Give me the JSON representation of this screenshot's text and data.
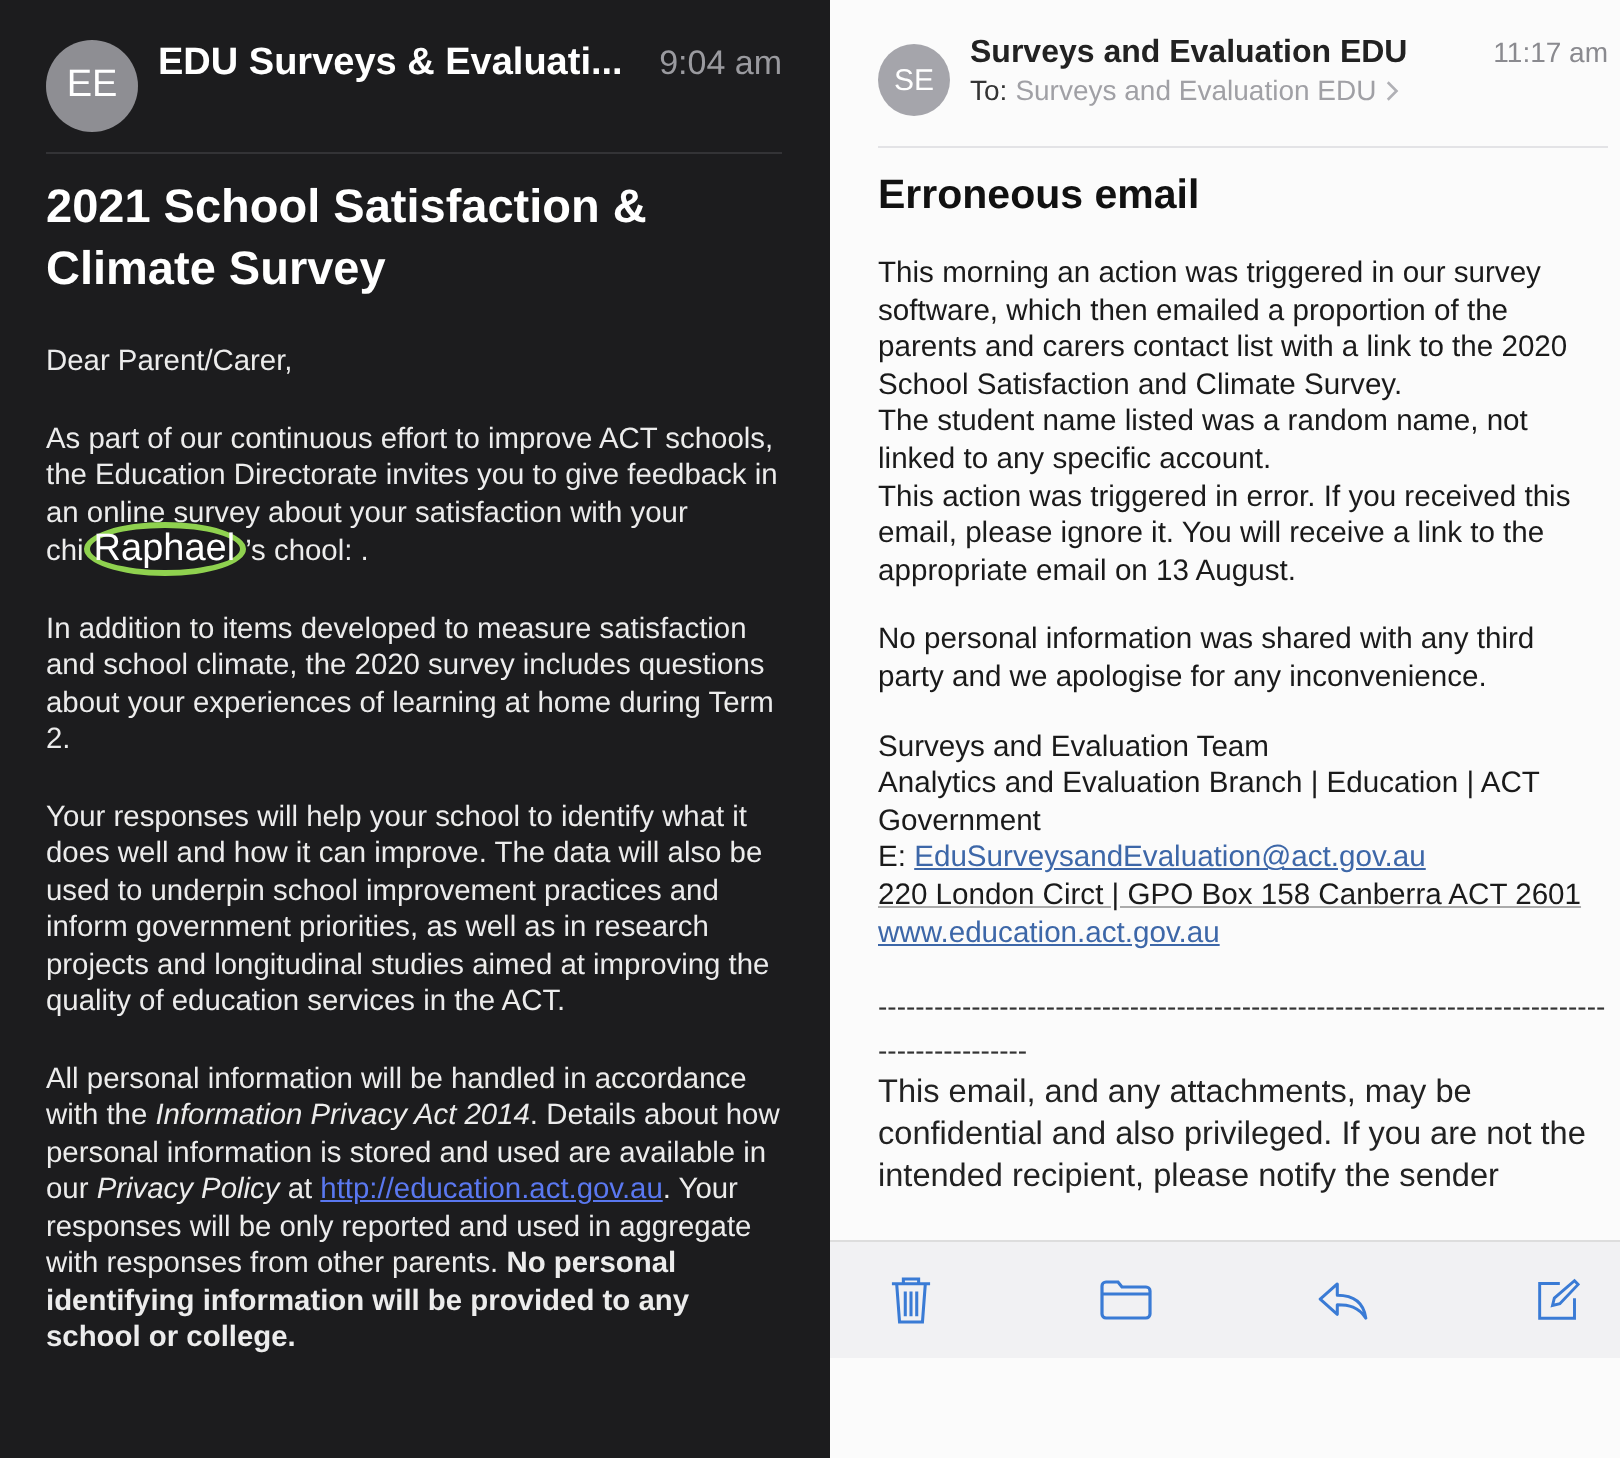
{
  "left_email": {
    "avatar": "EE",
    "sender": "EDU Surveys & Evaluati...",
    "time": "9:04 am",
    "subject": "2021 School Satisfaction & Climate Survey",
    "greeting": "Dear Parent/Carer,",
    "paragraphs": [
      {
        "segments": [
          {
            "kind": "text",
            "text": "As part of our continuous effort to improve ACT schools, the Education Directorate invites you to give feedback in an online survey about your satisfaction with your chi"
          },
          {
            "kind": "annotation",
            "text": "Raphael"
          },
          {
            "kind": "text",
            "text": "’s chool: ."
          }
        ]
      },
      {
        "segments": [
          {
            "kind": "text",
            "text": "In addition to items developed to measure satisfaction and school climate, the 2020 survey includes questions about your experiences of learning at home during Term 2."
          }
        ]
      },
      {
        "segments": [
          {
            "kind": "text",
            "text": "Your responses will help your school to identify what it does well and how it can improve. The data will also be used to underpin school improvement practices and inform government priorities, as well as in research projects and longitudinal studies aimed at improving the quality of education services in the ACT."
          }
        ]
      },
      {
        "segments": [
          {
            "kind": "text",
            "text": "All personal information will be handled in accordance with the *Information Privacy Act 2014*. Details about how personal information is stored and used are available in our *Privacy Policy* at "
          },
          {
            "kind": "link",
            "text": "http://education.act.gov.au"
          },
          {
            "kind": "text",
            "text": ". Your responses will be only reported and used in aggregate with responses from other parents. **No personal identifying information will be provided to any school or college.**"
          }
        ]
      }
    ]
  },
  "right_email": {
    "avatar": "SE",
    "sender": "Surveys and Evaluation EDU",
    "time": "11:17 am",
    "to_label": "To:",
    "to": "Surveys and Evaluation EDU",
    "subject": "Erroneous email",
    "paragraphs": [
      {
        "lines": [
          {
            "segments": [
              {
                "kind": "text",
                "text": "This morning an action was triggered in our survey software, which then emailed a proportion of the parents and carers contact list with a link to the 2020 School Satisfaction and Climate Survey."
              }
            ]
          },
          {
            "segments": [
              {
                "kind": "text",
                "text": "The student name listed was a random name, not linked to any specific account."
              }
            ]
          },
          {
            "segments": [
              {
                "kind": "text",
                "text": "This action was triggered in error. If you received this email, please ignore it. You will receive a link to the appropriate email on 13 August."
              }
            ]
          }
        ]
      },
      {
        "lines": [
          {
            "segments": [
              {
                "kind": "text",
                "text": "No personal information was shared with any third party and we apologise for any inconvenience."
              }
            ]
          }
        ]
      },
      {
        "lines": [
          {
            "segments": [
              {
                "kind": "text",
                "text": "Surveys and Evaluation Team"
              }
            ]
          },
          {
            "segments": [
              {
                "kind": "text",
                "text": "Analytics and Evaluation Branch | Education | ACT Government"
              }
            ]
          },
          {
            "segments": [
              {
                "kind": "text",
                "text": "E: "
              },
              {
                "kind": "link",
                "text": "EduSurveysandEvaluation@act.gov.au"
              }
            ]
          },
          {
            "segments": [
              {
                "kind": "address",
                "text": "220 London Circt | GPO Box 158 Canberra ACT 2601"
              }
            ]
          },
          {
            "segments": [
              {
                "kind": "link",
                "text": "www.education.act.gov.au"
              }
            ]
          }
        ]
      }
    ],
    "separator": "----------------------------------------------------------------------------------------------",
    "disclaimer": "This email, and any attachments, may be confidential and also privileged. If you are not the intended recipient, please notify the sender",
    "toolbar": [
      {
        "kind": "trash"
      },
      {
        "kind": "folder"
      },
      {
        "kind": "reply"
      },
      {
        "kind": "compose"
      }
    ]
  }
}
